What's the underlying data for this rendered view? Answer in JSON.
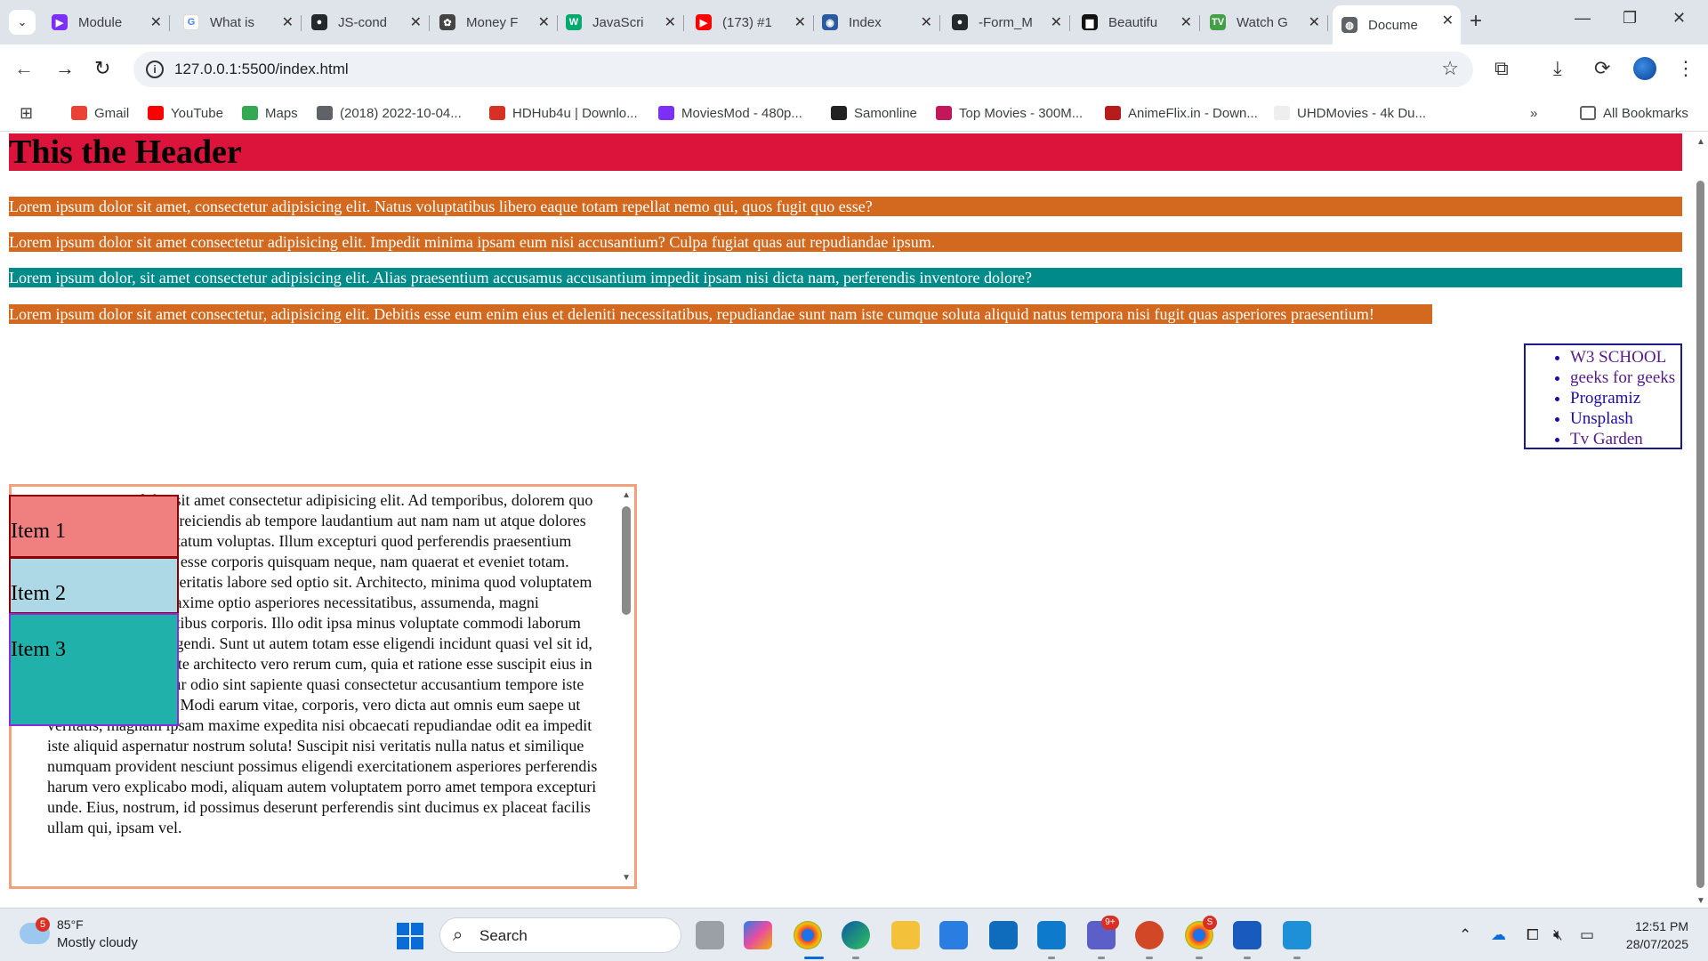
{
  "browser": {
    "tabs": [
      {
        "title": "Module",
        "icon": "module-icon",
        "color": "#7b2ff7",
        "glyph": "▶"
      },
      {
        "title": "What is",
        "icon": "google-icon",
        "color": "#ffffff",
        "glyph": "G"
      },
      {
        "title": "JS-cond",
        "icon": "github-icon",
        "color": "#24292e",
        "glyph": "●"
      },
      {
        "title": "Money F",
        "icon": "openai-icon",
        "color": "#444444",
        "glyph": "✿"
      },
      {
        "title": "JavaScri",
        "icon": "w3schools-icon",
        "color": "#04aa6d",
        "glyph": "W"
      },
      {
        "title": "(173) #1",
        "icon": "youtube-icon",
        "color": "#ff0000",
        "glyph": "▶"
      },
      {
        "title": "Index",
        "icon": "globe-icon",
        "color": "#2c5aa0",
        "glyph": "◉"
      },
      {
        "title": "-Form_M",
        "icon": "github-icon",
        "color": "#24292e",
        "glyph": "●"
      },
      {
        "title": "Beautifu",
        "icon": "unsplash-icon",
        "color": "#111111",
        "glyph": "▆"
      },
      {
        "title": "Watch G",
        "icon": "tv-icon",
        "color": "#43a047",
        "glyph": "TV"
      },
      {
        "title": "Docume",
        "icon": "globe-icon",
        "color": "#5f6368",
        "glyph": "◍"
      }
    ],
    "url": "127.0.0.1:5500/index.html",
    "bookmarks": [
      {
        "label": "Gmail",
        "icon": "gmail-icon",
        "color": "#ea4335"
      },
      {
        "label": "YouTube",
        "icon": "youtube-icon",
        "color": "#ff0000"
      },
      {
        "label": "Maps",
        "icon": "maps-icon",
        "color": "#34a853"
      },
      {
        "label": "(2018) 2022-10-04...",
        "icon": "folder-icon",
        "color": "#5f6368"
      },
      {
        "label": "HDHub4u | Downlo...",
        "icon": "hd-icon",
        "color": "#d93025"
      },
      {
        "label": "MoviesMod - 480p...",
        "icon": "moviesmod-icon",
        "color": "#7b2ff7"
      },
      {
        "label": "Samonline",
        "icon": "samonline-icon",
        "color": "#222222"
      },
      {
        "label": "Top Movies - 300M...",
        "icon": "topmovies-icon",
        "color": "#c2185b"
      },
      {
        "label": "AnimeFlix.in - Down...",
        "icon": "animeflix-icon",
        "color": "#b71c1c"
      },
      {
        "label": "UHDMovies - 4k Du...",
        "icon": "uhdmovies-icon",
        "color": "#eeeeee"
      }
    ],
    "all_bookmarks": "All Bookmarks"
  },
  "page": {
    "header": "This the Header",
    "paragraphs": [
      {
        "text": "Lorem ipsum dolor sit amet, consectetur adipisicing elit. Natus voluptatibus libero eaque totam repellat nemo qui, quos fugit quo esse?",
        "bg": "#d2691e"
      },
      {
        "text": "Lorem ipsum dolor sit amet consectetur adipisicing elit. Impedit minima ipsam eum nisi accusantium? Culpa fugiat quas aut repudiandae ipsum.",
        "bg": "#d2691e"
      },
      {
        "text": "Lorem ipsum dolor, sit amet consectetur adipisicing elit. Alias praesentium accusamus accusantium impedit ipsam nisi dicta nam, perferendis inventore dolore?",
        "bg": "#008b8b"
      },
      {
        "text": "Lorem ipsum dolor sit amet consectetur, adipisicing elit. Debitis esse eum enim eius et deleniti necessitatibus, repudiandae sunt nam iste cumque soluta aliquid natus tempora nisi fugit quas asperiores praesentium!",
        "bg": "#d2691e"
      }
    ],
    "links": [
      {
        "label": "W3 SCHOOL",
        "visited": true
      },
      {
        "label": "geeks for geeks",
        "visited": true
      },
      {
        "label": "Programiz",
        "visited": false
      },
      {
        "label": "Unsplash",
        "visited": false
      },
      {
        "label": "Tv Garden",
        "visited": true
      }
    ],
    "scroll_text": "Lorem ipsum dolor sit amet consectetur adipisicing elit. Ad temporibus, dolorem quo harum asperiores ea reiciendis ab tempore laudantium aut nam nam ut atque dolores accusamus sit voluptatum voluptas. Illum excepturi quod perferendis praesentium deserunt. Voluptates esse corporis quisquam neque, nam quaerat et eveniet totam. Suscipit modi cum veritatis labore sed optio sit. Architecto, minima quod voluptatem neque fugiat cum maxime optio asperiores necessitatibus, assumenda, magni doloremque voluptatibus corporis. Illo odit ipsa minus voluptate commodi laborum quia facilis illum eligendi. Sunt ut autem totam esse eligendi incidunt quasi vel sit id, quas labore. Voluptate architecto vero rerum cum, quia et ratione esse suscipit eius in possimus, est pariatur odio sint sapiente quasi consectetur accusantium tempore iste dolorem error nihil? Modi earum vitae, corporis, vero dicta aut omnis eum saepe ut veritatis, magnam ipsam maxime expedita nisi obcaecati repudiandae odit ea impedit iste aliquid aspernatur nostrum soluta! Suscipit nisi veritatis nulla natus et similique numquam provident nesciunt possimus eligendi exercitationem asperiores perferendis harum vero explicabo modi, aliquam autem voluptatem porro amet tempora excepturi unde. Eius, nostrum, id possimus deserunt perferendis sint ducimus ex placeat facilis ullam qui, ipsam vel.",
    "items": [
      {
        "label": "Item 1",
        "bg": "#f08080",
        "border": "#8b0000"
      },
      {
        "label": "Item 2",
        "bg": "#add8e6",
        "border": "#8b0000"
      },
      {
        "label": "Item 3",
        "bg": "#20b2aa",
        "border": "#8a2be2"
      }
    ]
  },
  "taskbar": {
    "weather_badge": "5",
    "temperature": "85°F",
    "condition": "Mostly cloudy",
    "search_placeholder": "Search",
    "teams_badge": "9+",
    "chrome2_badge": "S",
    "time": "12:51 PM",
    "date": "28/07/2025"
  }
}
